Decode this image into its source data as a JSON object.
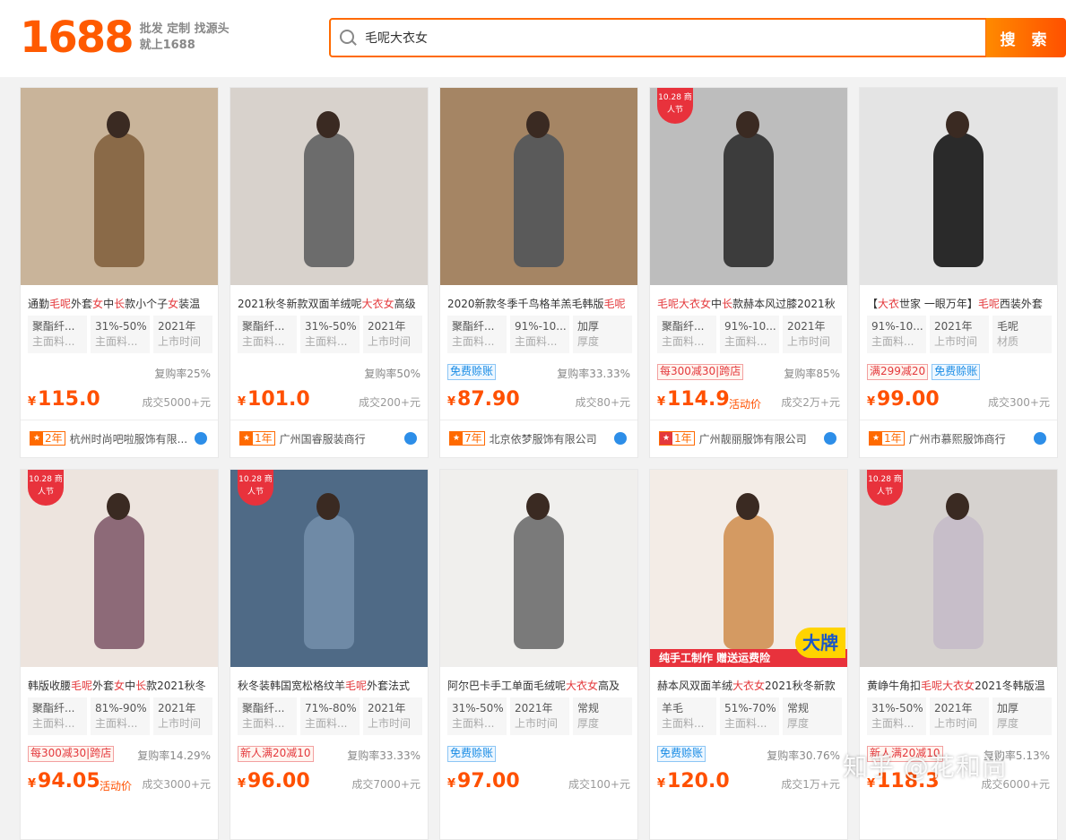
{
  "header": {
    "logo": "1688",
    "slogan_line1": "批发 定制 找源头",
    "slogan_line2": "就上1688",
    "search_value": "毛呢大衣女",
    "search_button": "搜 索"
  },
  "products": [
    {
      "title": "通勤毛呢外套女中长款小个子女装温",
      "attrs": [
        [
          "聚酯纤...",
          "主面料..."
        ],
        [
          "31%-50%",
          "主面料..."
        ],
        [
          "2021年",
          "上市时间"
        ]
      ],
      "promos": [],
      "rebuy": "复购率25%",
      "price": "115.0",
      "activity": "",
      "deals": "成交5000+元",
      "years": "2年",
      "shop": "杭州时尚吧啦服饰有限...",
      "badge": false,
      "imgcolor": "#c9b49a",
      "coat": "#8a6a48"
    },
    {
      "title": "2021秋冬新款双面羊绒呢大衣女高级",
      "attrs": [
        [
          "聚酯纤...",
          "主面料..."
        ],
        [
          "31%-50%",
          "主面料..."
        ],
        [
          "2021年",
          "上市时间"
        ]
      ],
      "promos": [],
      "rebuy": "复购率50%",
      "price": "101.0",
      "activity": "",
      "deals": "成交200+元",
      "years": "1年",
      "shop": "广州国睿服装商行",
      "badge": false,
      "imgcolor": "#d8d2cc",
      "coat": "#6c6c6c"
    },
    {
      "title": "2020新款冬季千鸟格羊羔毛韩版毛呢",
      "attrs": [
        [
          "聚酯纤...",
          "主面料..."
        ],
        [
          "91%-10...",
          "主面料..."
        ],
        [
          "加厚",
          "厚度"
        ]
      ],
      "promos": [
        {
          "text": "免费赊账",
          "type": "blue"
        }
      ],
      "rebuy": "复购率33.33%",
      "price": "87.90",
      "activity": "",
      "deals": "成交80+元",
      "years": "7年",
      "shop": "北京依梦服饰有限公司",
      "badge": false,
      "imgcolor": "#a58564",
      "coat": "#5a5a5a"
    },
    {
      "title": "毛呢大衣女中长款赫本风过膝2021秋",
      "attrs": [
        [
          "聚酯纤...",
          "主面料..."
        ],
        [
          "91%-10...",
          "主面料..."
        ],
        [
          "2021年",
          "上市时间"
        ]
      ],
      "promos": [
        {
          "text": "每300减30|跨店",
          "type": "red"
        }
      ],
      "rebuy": "复购率85%",
      "price": "114.9",
      "activity": "活动价",
      "deals": "成交2万+元",
      "years": "1年",
      "shop": "广州靓丽服饰有限公司",
      "badge": true,
      "imgcolor": "#bdbdbd",
      "coat": "#3c3c3c"
    },
    {
      "title": "【大衣世家 一眼万年】毛呢西装外套",
      "attrs": [
        [
          "91%-10...",
          "主面料..."
        ],
        [
          "2021年",
          "上市时间"
        ],
        [
          "毛呢",
          "材质"
        ]
      ],
      "promos": [
        {
          "text": "满299减20",
          "type": "red"
        },
        {
          "text": "免费赊账",
          "type": "blue"
        }
      ],
      "rebuy": "",
      "price": "99.00",
      "activity": "",
      "deals": "成交300+元",
      "years": "1年",
      "shop": "广州市慕熙服饰商行",
      "badge": false,
      "imgcolor": "#e4e4e4",
      "coat": "#2a2a2a"
    },
    {
      "title": "韩版收腰毛呢外套女中长款2021秋冬",
      "attrs": [
        [
          "聚酯纤...",
          "主面料..."
        ],
        [
          "81%-90%",
          "主面料..."
        ],
        [
          "2021年",
          "上市时间"
        ]
      ],
      "promos": [
        {
          "text": "每300减30|跨店",
          "type": "red"
        }
      ],
      "rebuy": "复购率14.29%",
      "price": "94.05",
      "activity": "活动价",
      "deals": "成交3000+元",
      "years": "",
      "shop": "",
      "badge": true,
      "imgcolor": "#ede4de",
      "coat": "#8d6a78"
    },
    {
      "title": "秋冬装韩国宽松格纹羊毛呢外套法式",
      "attrs": [
        [
          "聚酯纤...",
          "主面料..."
        ],
        [
          "71%-80%",
          "主面料..."
        ],
        [
          "2021年",
          "上市时间"
        ]
      ],
      "promos": [
        {
          "text": "新人满20减10",
          "type": "red"
        }
      ],
      "rebuy": "复购率33.33%",
      "price": "96.00",
      "activity": "",
      "deals": "成交7000+元",
      "years": "",
      "shop": "",
      "badge": true,
      "imgcolor": "#4f6a86",
      "coat": "#6f8aa6"
    },
    {
      "title": "阿尔巴卡手工单面毛绒呢大衣女高及",
      "attrs": [
        [
          "31%-50%",
          "主面料..."
        ],
        [
          "2021年",
          "上市时间"
        ],
        [
          "常规",
          "厚度"
        ]
      ],
      "promos": [
        {
          "text": "免费赊账",
          "type": "blue"
        }
      ],
      "rebuy": "",
      "price": "97.00",
      "activity": "",
      "deals": "成交100+元",
      "years": "",
      "shop": "",
      "badge": false,
      "imgcolor": "#f0efed",
      "coat": "#7a7a7a"
    },
    {
      "title": "赫本风双面羊绒大衣女2021秋冬新款",
      "attrs": [
        [
          "羊毛",
          "主面料..."
        ],
        [
          "51%-70%",
          "主面料..."
        ],
        [
          "常规",
          "厚度"
        ]
      ],
      "promos": [
        {
          "text": "免费赊账",
          "type": "blue"
        }
      ],
      "rebuy": "复购率30.76%",
      "price": "120.0",
      "activity": "",
      "deals": "成交1万+元",
      "years": "",
      "shop": "",
      "badge": false,
      "imgcolor": "#f3ece6",
      "coat": "#d49a62",
      "banner": "纯手工制作  赠送运费险",
      "bigbrand": "大牌"
    },
    {
      "title": "黄峥牛角扣毛呢大衣女2021冬韩版温",
      "attrs": [
        [
          "31%-50%",
          "主面料..."
        ],
        [
          "2021年",
          "上市时间"
        ],
        [
          "加厚",
          "厚度"
        ]
      ],
      "promos": [
        {
          "text": "新人满20减10",
          "type": "red"
        }
      ],
      "rebuy": "复购率5.13%",
      "price": "118.3",
      "activity": "",
      "deals": "成交6000+元",
      "years": "",
      "shop": "",
      "badge": true,
      "imgcolor": "#d6d2cf",
      "coat": "#c7bec9"
    }
  ],
  "badge_text": "10.28 商人节",
  "currency": "¥",
  "watermark": "知乎 @花和尚"
}
